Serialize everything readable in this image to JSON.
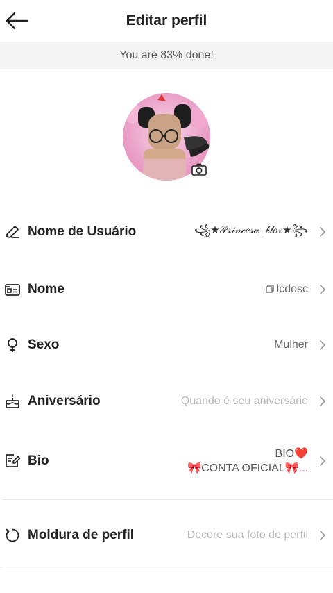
{
  "header": {
    "title": "Editar perfil"
  },
  "progress": {
    "text": "You are 83% done!"
  },
  "rows": {
    "username": {
      "label": "Nome de Usuário",
      "value": "꧁★𝒫𝓇𝒾𝓃𝒸𝑒𝓈𝒶_𝒷𝓁𝑜𝓍★꧂"
    },
    "name": {
      "label": "Nome",
      "value": "lcdosc"
    },
    "gender": {
      "label": "Sexo",
      "value": "Mulher"
    },
    "birthday": {
      "label": "Aniversário",
      "value": "Quando é seu aniversário"
    },
    "bio": {
      "label": "Bio",
      "line1": "BIO",
      "line1_emoji": "❤️",
      "line2_emoji": "🎀",
      "line2": "CONTA OFICIAL",
      "line2_suffix": "🎀..."
    },
    "frame": {
      "label": "Moldura de perfil",
      "value": "Decore sua foto de perfil"
    }
  },
  "icons": {
    "back": "arrow-left-icon",
    "camera": "camera-icon",
    "username": "pencil-icon",
    "name": "id-card-icon",
    "gender": "gender-icon",
    "birthday": "cake-icon",
    "bio": "note-edit-icon",
    "frame": "refresh-circle-icon",
    "chevron": "chevron-right-icon"
  },
  "colors": {
    "text": "#222222",
    "muted": "#666666",
    "placeholder": "#b9b9b9",
    "banner": "#f3f3f3"
  }
}
